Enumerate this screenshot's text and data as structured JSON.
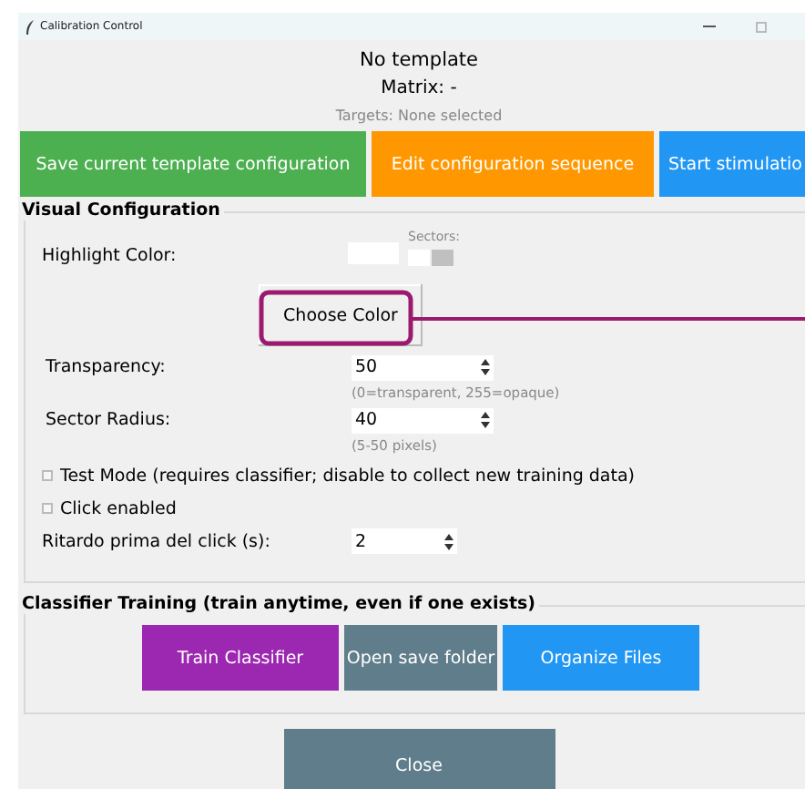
{
  "window": {
    "title": "Calibration Control"
  },
  "header": {
    "template": "No template",
    "matrix": "Matrix: -",
    "targets": "Targets: None selected"
  },
  "top_buttons": [
    {
      "label": "Save current template configuration",
      "color": "#4caf50"
    },
    {
      "label": "Edit configuration sequence",
      "color": "#ff9800"
    },
    {
      "label": "Start stimulatio",
      "color": "#2196f3"
    }
  ],
  "visual_configuration": {
    "title": "Visual Configuration",
    "highlight": {
      "label": "Highlight Color:",
      "color": "#ffffff",
      "sectors_label": "Sectors:",
      "sectors": [
        {
          "color": "#ffffff"
        },
        {
          "color": "#c0c0c0"
        }
      ],
      "button": "Choose Color"
    },
    "fields": [
      {
        "label": "Transparency:",
        "value": "50",
        "hint": "(0=transparent, 255=opaque)"
      },
      {
        "label": "Sector Radius:",
        "value": "40",
        "hint": "(5-50 pixels)"
      }
    ],
    "checkboxes": [
      {
        "label": "Test Mode (requires classifier; disable to collect new training data)",
        "checked": false
      },
      {
        "label": "Click enabled",
        "checked": false
      }
    ],
    "delay": {
      "label": "Ritardo prima del click (s):",
      "value": "2"
    }
  },
  "classifier_training": {
    "title": "Classifier Training (train anytime, even if one exists)",
    "buttons": [
      {
        "label": "Train Classifier",
        "color": "#9c27b0"
      },
      {
        "label": "Open save folder",
        "color": "#607d8b"
      },
      {
        "label": "Organize Files",
        "color": "#2196f3"
      }
    ]
  },
  "close_button": {
    "label": "Close",
    "color": "#607d8b"
  }
}
